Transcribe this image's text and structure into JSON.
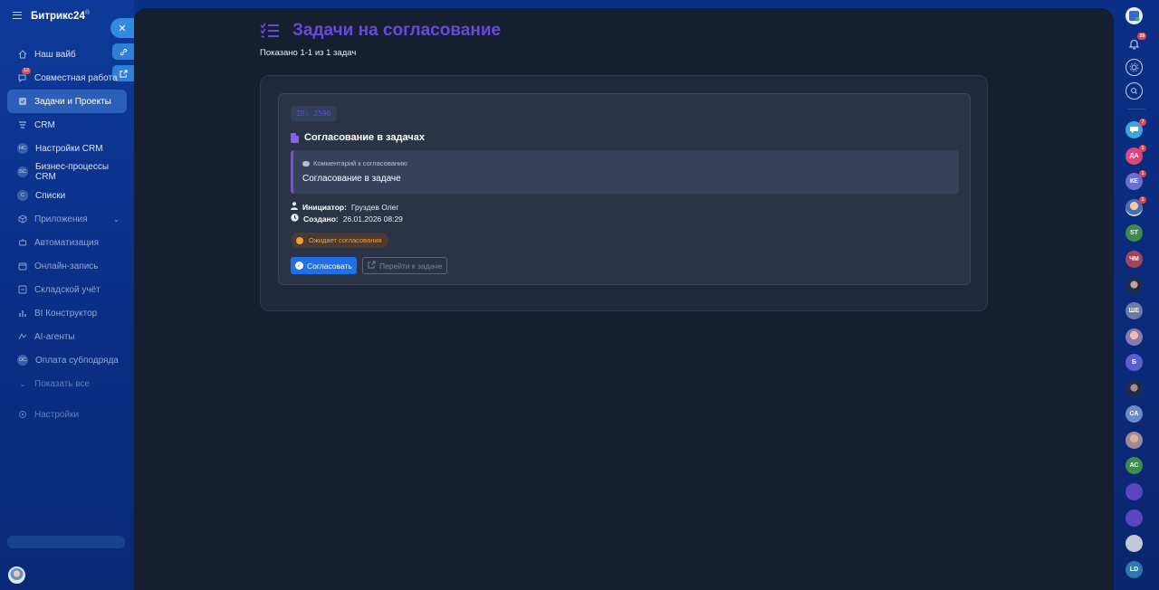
{
  "sidebar": {
    "brand": "Битрикс24",
    "brand_mark": "®",
    "close_glyph": "✕",
    "items": [
      {
        "label": "Наш вайб",
        "icon": "home-icon"
      },
      {
        "label": "Совместная работа",
        "icon": "chat-icon",
        "badge": "12"
      },
      {
        "label": "Задачи и Проекты",
        "icon": "tasks-icon",
        "active": true
      },
      {
        "label": "CRM",
        "icon": "crm-icon"
      },
      {
        "label": "Настройки CRM",
        "icon": "circle-nc",
        "abbr": "НС"
      },
      {
        "label": "Бизнес-процессы CRM",
        "icon": "circle-bc",
        "abbr": "БС"
      },
      {
        "label": "Списки",
        "icon": "circle-c",
        "abbr": "С"
      },
      {
        "label": "Приложения",
        "icon": "apps-icon"
      },
      {
        "label": "Автоматизация",
        "icon": "robot-icon"
      },
      {
        "label": "Онлайн-запись",
        "icon": "calendar-icon"
      },
      {
        "label": "Складской учёт",
        "icon": "warehouse-icon"
      },
      {
        "label": "BI Конструктор",
        "icon": "chart-icon"
      },
      {
        "label": "AI-агенты",
        "icon": "ai-icon"
      },
      {
        "label": "Оплата субподряда",
        "icon": "circle-oc",
        "abbr": "ОС"
      },
      {
        "label": "Показать все",
        "icon": "chevron-down-icon"
      },
      {
        "label": "Настройки",
        "icon": "gear-icon"
      }
    ]
  },
  "page": {
    "title": "Задачи на согласование",
    "subtitle": "Показано 1-1 из 1 задач"
  },
  "card": {
    "id_label": "ID: 2590",
    "title": "Согласование в задачах",
    "comment_label": "Комментарий к согласованию",
    "comment_text": "Согласование в задаче",
    "initiator_label": "Инициатор:",
    "initiator_value": "Груздев Олег",
    "created_label": "Создано:",
    "created_value": "26.01.2026 08:29",
    "status": "Ожидает согласования",
    "approve_label": "Согласовать",
    "goto_label": "Перейти к задаче"
  },
  "rightbar": {
    "bell_badge": "29",
    "items": [
      {
        "abbr": "",
        "color": "#3aa6e0",
        "badge": "7"
      },
      {
        "abbr": "ДА",
        "color": "#e0457a",
        "badge": "1"
      },
      {
        "abbr": "КЕ",
        "color": "#6a6fcf",
        "badge": "1"
      },
      {
        "abbr": "",
        "color": "#8fa8d8",
        "badge": "1"
      },
      {
        "abbr": "ST",
        "color": "#3f8a4f"
      },
      {
        "abbr": "ЧМ",
        "color": "#a0465a"
      },
      {
        "abbr": "",
        "color": "#2d3f6a"
      },
      {
        "abbr": "ШЕ",
        "color": "#6a7aa8"
      },
      {
        "abbr": "",
        "color": "#8a7ab0"
      },
      {
        "abbr": "Б",
        "color": "#5a5fcf"
      },
      {
        "abbr": "",
        "color": "#1c2c4a"
      },
      {
        "abbr": "СА",
        "color": "#6a8ac8"
      },
      {
        "abbr": "",
        "color": "#a08a9a"
      },
      {
        "abbr": "АС",
        "color": "#3f8a4f"
      },
      {
        "abbr": "",
        "color": "#5a47c0"
      },
      {
        "abbr": "",
        "color": "#5a47c0"
      },
      {
        "abbr": "",
        "color": "#c0c8d8"
      },
      {
        "abbr": "LD",
        "color": "#2a7ab0"
      }
    ]
  },
  "colors": {
    "accent_purple": "#6b47e0",
    "approve_blue": "#1f6fe8",
    "status_orange": "#f0a03a"
  }
}
